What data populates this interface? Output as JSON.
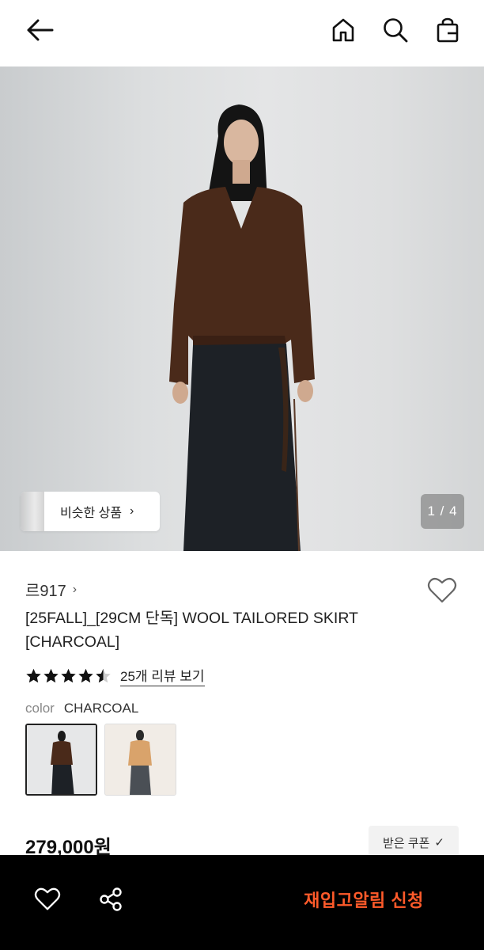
{
  "header": {
    "back_icon": "arrow-left-icon",
    "home_icon": "home-icon",
    "search_icon": "search-icon",
    "cart_icon": "shopping-bag-icon"
  },
  "hero": {
    "similar_label": "비슷한 상품",
    "similar_chevron": "›",
    "pager": "1 / 4"
  },
  "product": {
    "brand": "르917",
    "brand_chevron": "›",
    "title": "[25FALL]_[29CM 단독] WOOL TAILORED SKIRT [CHARCOAL]",
    "rating": 4.5,
    "review_link": "25개 리뷰 보기",
    "color_key": "color",
    "color_value": "CHARCOAL",
    "swatches": [
      "charcoal",
      "melange"
    ],
    "price": "279,000원",
    "coupon": "받은 쿠폰",
    "coupon_check": "✓"
  },
  "bottom_bar": {
    "like_icon": "heart-icon",
    "share_icon": "share-icon",
    "restock_label": "재입고알림 신청",
    "restock_color": "#ff5a2a"
  }
}
